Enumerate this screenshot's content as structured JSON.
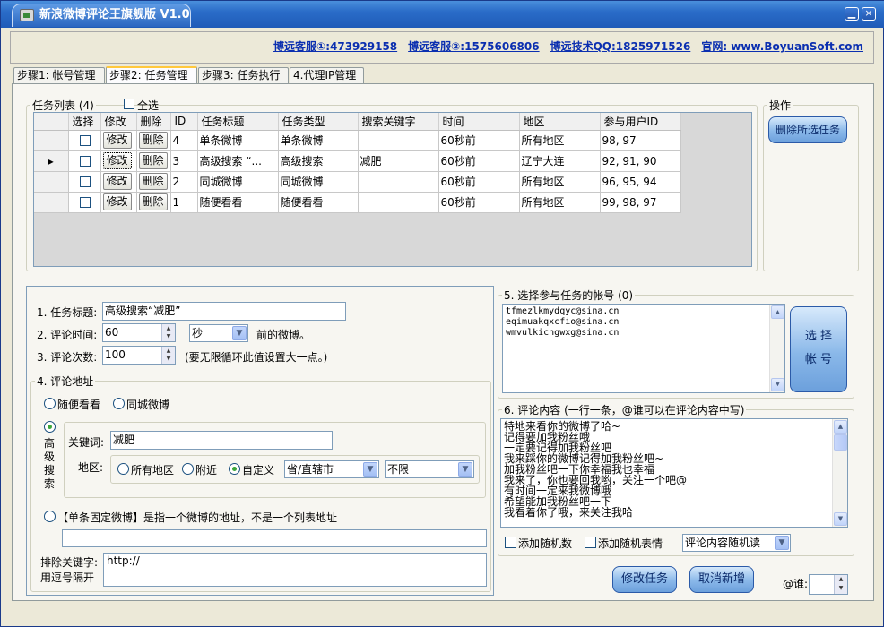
{
  "window": {
    "title": "新浪微博评论王旗舰版 V1.0",
    "minimize_label": "▁",
    "close_label": "×"
  },
  "header": {
    "links": [
      "博远客服①:473929158",
      "博远客服②:1575606806",
      "博远技术QQ:1825971526",
      "官网: www.BoyuanSoft.com"
    ]
  },
  "tabs": [
    "步骤1: 帐号管理",
    "步骤2: 任务管理",
    "步骤3: 任务执行",
    "4.代理IP管理"
  ],
  "task_list": {
    "legend": "任务列表 (4)",
    "select_all": "全选",
    "columns": [
      "选择",
      "修改",
      "删除",
      "ID",
      "任务标题",
      "任务类型",
      "搜索关键字",
      "时间",
      "地区",
      "参与用户ID"
    ],
    "edit_label": "修改",
    "delete_label": "删除",
    "current_row_marker": "▸",
    "rows": [
      {
        "id": "4",
        "title": "单条微博",
        "type": "单条微博",
        "keyword": "",
        "time": "60秒前",
        "region": "所有地区",
        "users": "98, 97"
      },
      {
        "id": "3",
        "title": "高级搜索 “...",
        "type": "高级搜索",
        "keyword": "减肥",
        "time": "60秒前",
        "region": "辽宁大连",
        "users": "92, 91, 90"
      },
      {
        "id": "2",
        "title": "同城微博",
        "type": "同城微博",
        "keyword": "",
        "time": "60秒前",
        "region": "所有地区",
        "users": "96, 95, 94"
      },
      {
        "id": "1",
        "title": "随便看看",
        "type": "随便看看",
        "keyword": "",
        "time": "60秒前",
        "region": "所有地区",
        "users": "99, 98, 97"
      }
    ]
  },
  "ops": {
    "legend": "操作",
    "delete_selected": "删除所选任务"
  },
  "form": {
    "task_title_label": "1. 任务标题:",
    "task_title_value": "高级搜索“减肥”",
    "comment_time_label": "2. 评论时间:",
    "comment_time_value": "60",
    "time_unit": "秒",
    "time_suffix": "前的微博。",
    "comment_count_label": "3. 评论次数:",
    "comment_count_value": "100",
    "count_hint": "(要无限循环此值设置大一点。)",
    "address_legend": "4. 评论地址",
    "opt_random": "随便看看",
    "opt_city": "同城微博",
    "adv_search": [
      "高",
      "级",
      "搜",
      "索"
    ],
    "keyword_label": "关键词:",
    "keyword_value": "减肥",
    "region_label": "地区:",
    "region_all": "所有地区",
    "region_near": "附近",
    "region_custom": "自定义",
    "province": "省/直辖市",
    "city": "不限",
    "single_label": "【单条固定微博】是指一个微博的地址，不是一个列表地址",
    "single_value": "",
    "exclude_label_1": "排除关键字:",
    "exclude_label_2": "用逗号隔开",
    "exclude_value": "http://"
  },
  "accounts": {
    "legend": "5. 选择参与任务的帐号 (0)",
    "list": [
      "tfmezlkmydqyc@sina.cn",
      "eqimuakqxcfio@sina.cn",
      "wmvulkicngwxg@sina.cn"
    ],
    "select_btn_1": "选 择",
    "select_btn_2": "帐 号"
  },
  "comments": {
    "legend": "6. 评论内容 (一行一条，@谁可以在评论内容中写)",
    "lines": [
      "特地来看你的微博了哈~",
      "记得要加我粉丝哦",
      "一定要记得加我粉丝吧",
      "我来踩你的微博记得加我粉丝吧~",
      "加我粉丝吧一下你幸福我也幸福",
      "我来了，你也要回我哟，关注一个吧@",
      "有时间一定来我微博哦",
      "希望能加我粉丝吧一下",
      "我看着你了哦，来关注我哈"
    ],
    "add_random_num": "添加随机数",
    "add_random_emoji": "添加随机表情",
    "mode": "评论内容随机读"
  },
  "actions": {
    "modify": "修改任务",
    "cancel": "取消新增",
    "at_label": "@谁:",
    "at_value": ""
  }
}
